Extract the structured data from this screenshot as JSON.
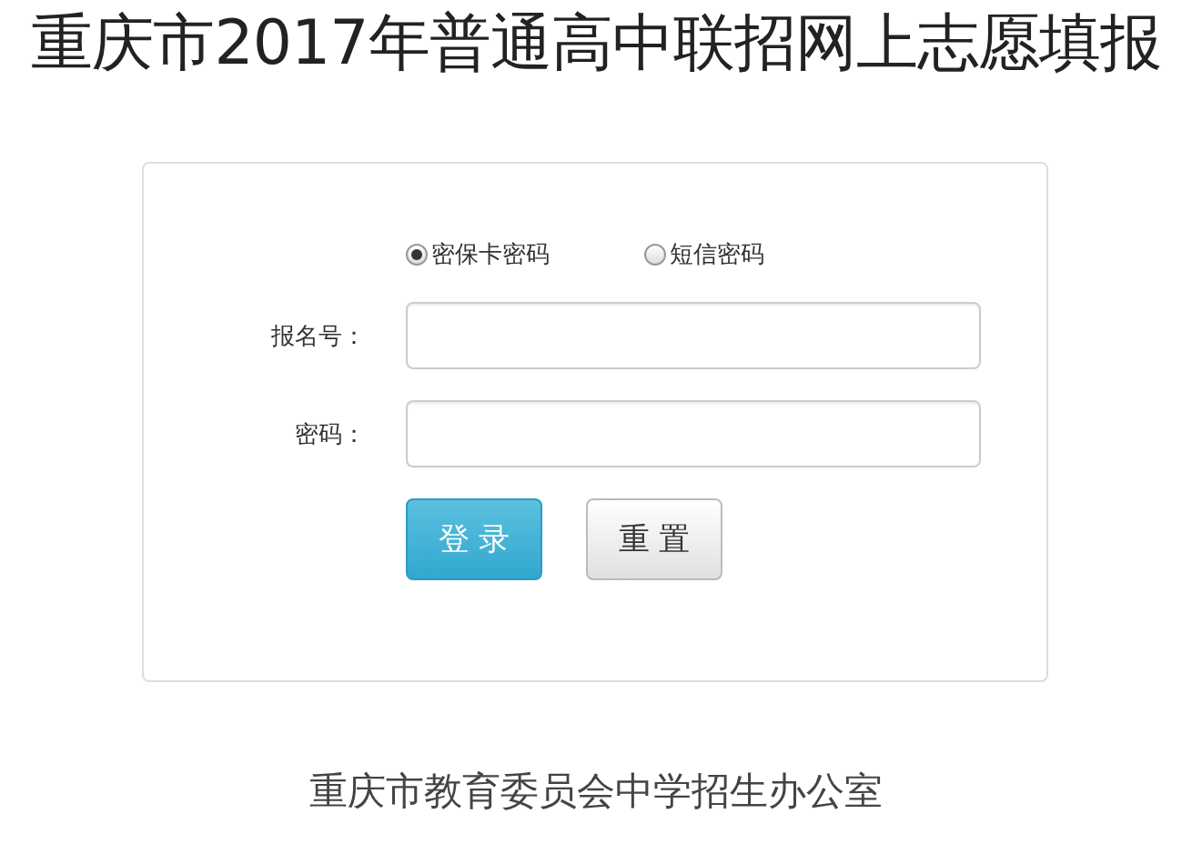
{
  "title": "重庆市2017年普通高中联招网上志愿填报",
  "login_type": [
    {
      "label": "密保卡密码",
      "selected": true
    },
    {
      "label": "短信密码",
      "selected": false
    }
  ],
  "fields": [
    {
      "label": "报名号："
    },
    {
      "label": "密码："
    }
  ],
  "buttons": [
    {
      "label": "登 录",
      "kind": "primary"
    },
    {
      "label": "重 置",
      "kind": "default"
    }
  ],
  "footer": "重庆市教育委员会中学招生办公室"
}
